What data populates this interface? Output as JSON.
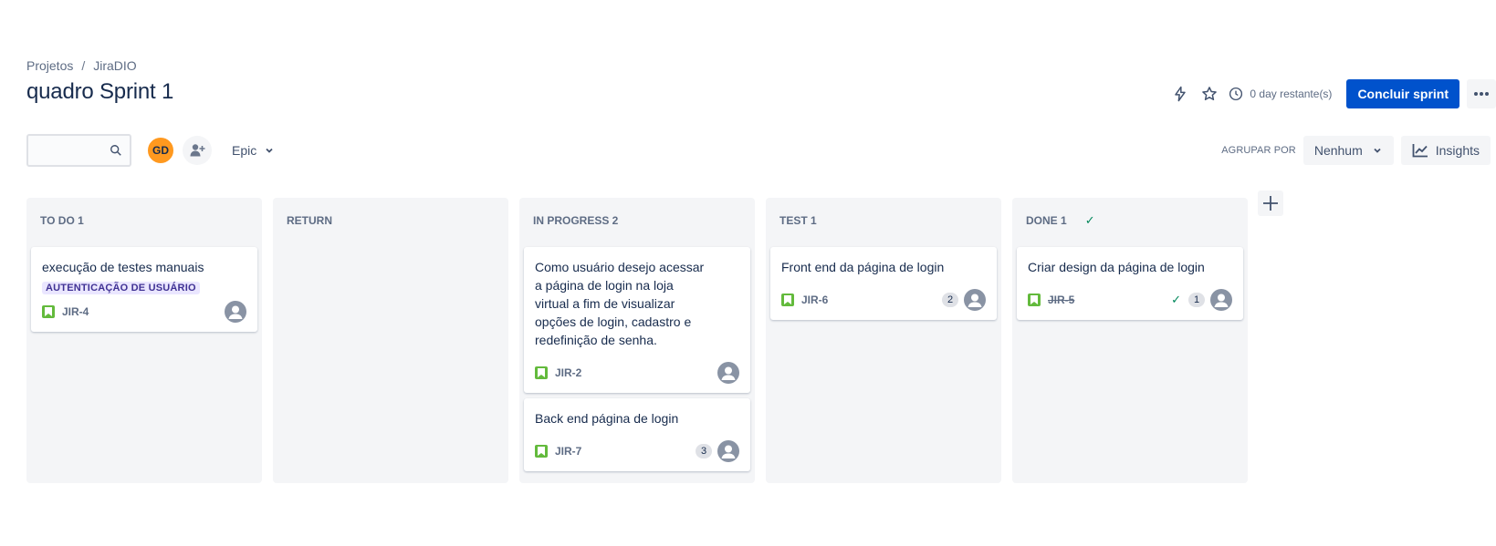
{
  "breadcrumb": {
    "projects": "Projetos",
    "separator": "/",
    "project": "JiraDIO"
  },
  "page_title": "quadro Sprint 1",
  "header": {
    "time_remaining": "0 day restante(s)",
    "complete_sprint": "Concluir sprint"
  },
  "toolbar": {
    "search_placeholder": "",
    "avatar_initials": "GD",
    "epic_filter": "Epic",
    "group_by_label": "AGRUPAR POR",
    "group_by_value": "Nenhum",
    "insights": "Insights"
  },
  "colors": {
    "primary": "#0052cc",
    "avatar": "#ff991f",
    "story": "#63ba3c",
    "epic_bg": "#eae6ff",
    "epic_text": "#403294",
    "done": "#00875a"
  },
  "columns": [
    {
      "title": "TO DO 1",
      "cards": [
        {
          "title": "execução de testes manuais",
          "epic": "AUTENTICAÇÃO DE USUÁRIO",
          "key": "JIR-4"
        }
      ]
    },
    {
      "title": "RETURN",
      "cards": []
    },
    {
      "title": "IN PROGRESS 2",
      "cards": [
        {
          "title": "Como usuário desejo acessar a página de login na loja virtual a fim de visualizar opções de login, cadastro e redefinição de senha.",
          "key": "JIR-2"
        },
        {
          "title": "Back end página de login",
          "key": "JIR-7",
          "estimate": "3"
        }
      ]
    },
    {
      "title": "TEST 1",
      "cards": [
        {
          "title": "Front end da página de login",
          "key": "JIR-6",
          "estimate": "2"
        }
      ]
    },
    {
      "title": "DONE 1",
      "cards": [
        {
          "title": "Criar design da página de login",
          "key": "JIR-5",
          "estimate": "1"
        }
      ]
    }
  ]
}
